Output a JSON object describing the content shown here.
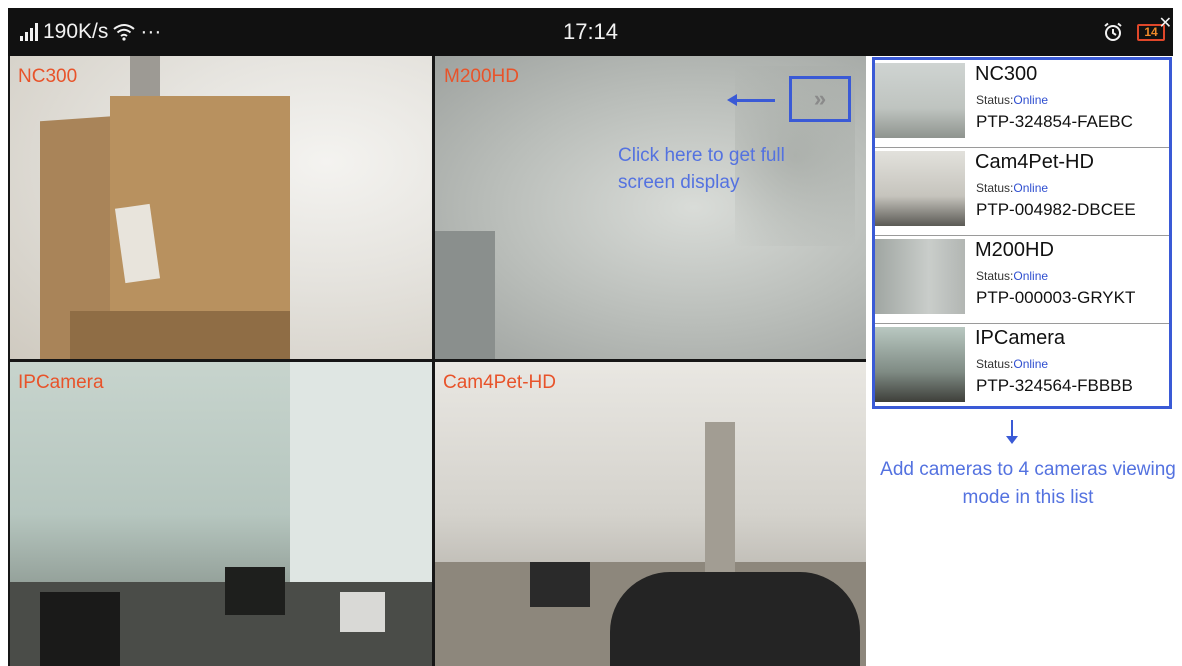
{
  "status_bar": {
    "network_speed": "190K/s",
    "overflow": "···",
    "time": "17:14",
    "battery": "14"
  },
  "cameras_grid": [
    {
      "label": "NC300"
    },
    {
      "label": "M200HD"
    },
    {
      "label": "IPCamera"
    },
    {
      "label": "Cam4Pet-HD"
    }
  ],
  "fullscreen": {
    "button_glyph": "»",
    "hint": "Click here to get full screen display"
  },
  "camera_list": {
    "status_prefix": "Status:",
    "items": [
      {
        "name": "NC300",
        "status": "Online",
        "id": "PTP-324854-FAEBC"
      },
      {
        "name": "Cam4Pet-HD",
        "status": "Online",
        "id": "PTP-004982-DBCEE"
      },
      {
        "name": "M200HD",
        "status": "Online",
        "id": "PTP-000003-GRYKT"
      },
      {
        "name": "IPCamera",
        "status": "Online",
        "id": "PTP-324564-FBBBB"
      }
    ],
    "hint": "Add cameras to 4 cameras viewing mode in this list"
  },
  "colors": {
    "annotation_blue": "#3a5ad6",
    "camera_label": "#e8532a",
    "status_online": "#2f4fd0"
  }
}
